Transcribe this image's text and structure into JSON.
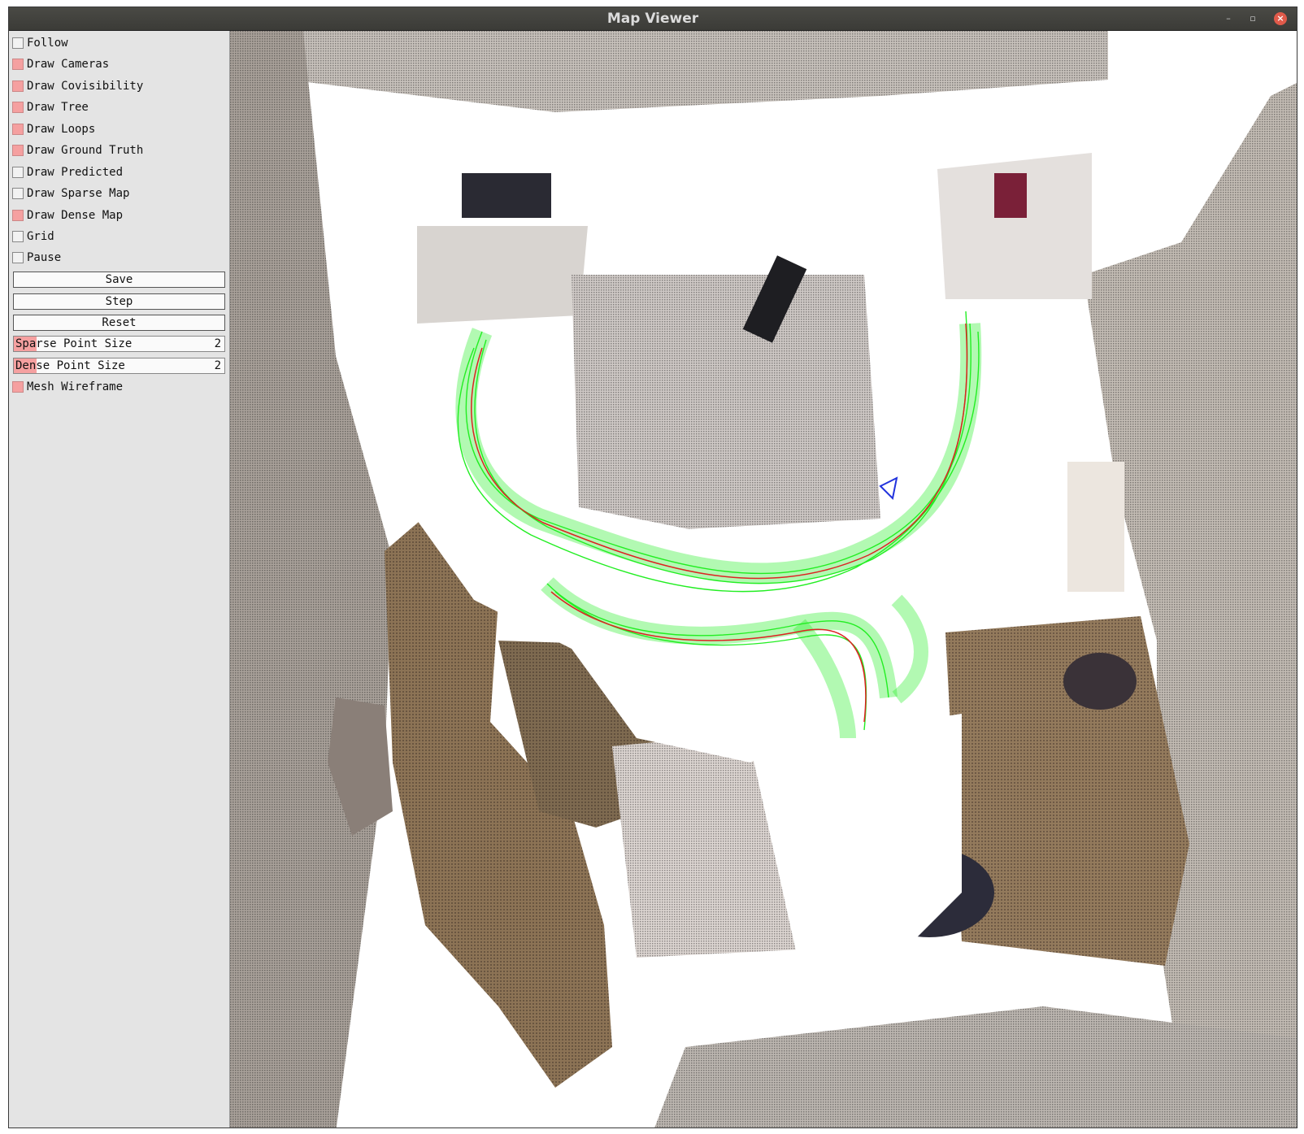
{
  "window": {
    "title": "Map Viewer",
    "min_glyph": "–",
    "max_glyph": "▫",
    "close_glyph": "×"
  },
  "panel": {
    "checkboxes": [
      {
        "label": "Follow",
        "checked": false
      },
      {
        "label": "Draw Cameras",
        "checked": true
      },
      {
        "label": "Draw Covisibility",
        "checked": true
      },
      {
        "label": "Draw Tree",
        "checked": true
      },
      {
        "label": "Draw Loops",
        "checked": true
      },
      {
        "label": "Draw Ground Truth",
        "checked": true
      },
      {
        "label": "Draw Predicted",
        "checked": false
      },
      {
        "label": "Draw Sparse Map",
        "checked": false
      },
      {
        "label": "Draw Dense Map",
        "checked": true
      },
      {
        "label": "Grid",
        "checked": false
      },
      {
        "label": "Pause",
        "checked": false
      }
    ],
    "buttons": [
      {
        "label": "Save"
      },
      {
        "label": "Step"
      },
      {
        "label": "Reset"
      }
    ],
    "sliders": [
      {
        "label": "Sparse Point Size",
        "value": "2"
      },
      {
        "label": "Dense Point Size",
        "value": "2"
      }
    ],
    "mesh_wireframe": {
      "label": "Mesh Wireframe",
      "checked": true
    }
  },
  "colors": {
    "checkbox_on": "#f5a0a0",
    "trajectory_frustums": "#22ee22",
    "trajectory_line": "#dd2222",
    "current_camera": "#2233dd",
    "floor": "#8c7355",
    "wall": "#c8c2bc"
  }
}
